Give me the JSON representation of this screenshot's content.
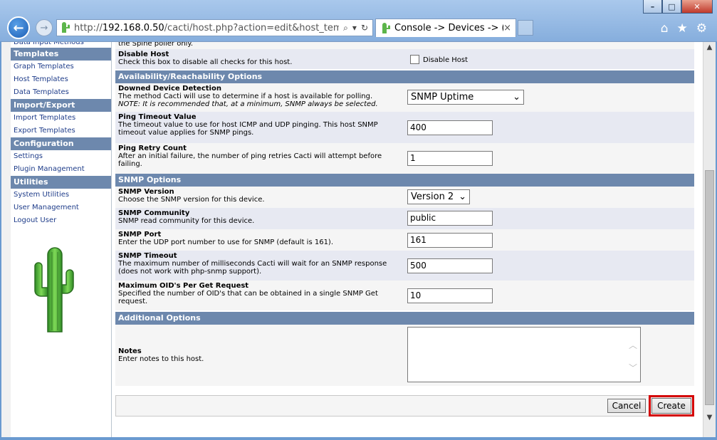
{
  "browser": {
    "address_url_prefix": "http://",
    "address_url_host": "192.168.0.50",
    "address_url_path": "/cacti/host.php?action=edit&host_templat",
    "tab_title": "Console -> Devices -> (...",
    "tab_close": "×",
    "win_min": "–",
    "win_max": "□",
    "win_close": "✕",
    "back_glyph": "←",
    "fwd_glyph": "→",
    "search_glyph": "⌕",
    "dropdown_glyph": "▾",
    "refresh_glyph": "↻",
    "home_glyph": "⌂",
    "fav_glyph": "★",
    "gear_glyph": "⚙"
  },
  "sidebar": {
    "partial_item": "Data Input Methods",
    "sections": [
      {
        "title": "Templates",
        "items": [
          "Graph Templates",
          "Host Templates",
          "Data Templates"
        ]
      },
      {
        "title": "Import/Export",
        "items": [
          "Import Templates",
          "Export Templates"
        ]
      },
      {
        "title": "Configuration",
        "items": [
          "Settings",
          "Plugin Management"
        ]
      },
      {
        "title": "Utilities",
        "items": [
          "System Utilities",
          "User Management",
          "Logout User"
        ]
      }
    ]
  },
  "form": {
    "top_partial_text": "the Spine poller only.",
    "disable_host": {
      "title": "Disable Host",
      "desc": "Check this box to disable all checks for this host.",
      "checkbox_label": "Disable Host"
    },
    "availability_section": "Availability/Reachability Options",
    "downed_detection": {
      "title": "Downed Device Detection",
      "desc": "The method Cacti will use to determine if a host is available for polling.",
      "note": "NOTE: It is recommended that, at a minimum, SNMP always be selected.",
      "value": "SNMP Uptime"
    },
    "ping_timeout": {
      "title": "Ping Timeout Value",
      "desc": "The timeout value to use for host ICMP and UDP pinging. This host SNMP timeout value applies for SNMP pings.",
      "value": "400"
    },
    "ping_retry": {
      "title": "Ping Retry Count",
      "desc": "After an initial failure, the number of ping retries Cacti will attempt before failing.",
      "value": "1"
    },
    "snmp_section": "SNMP Options",
    "snmp_version": {
      "title": "SNMP Version",
      "desc": "Choose the SNMP version for this device.",
      "value": "Version 2"
    },
    "snmp_community": {
      "title": "SNMP Community",
      "desc": "SNMP read community for this device.",
      "value": "public"
    },
    "snmp_port": {
      "title": "SNMP Port",
      "desc": "Enter the UDP port number to use for SNMP (default is 161).",
      "value": "161"
    },
    "snmp_timeout": {
      "title": "SNMP Timeout",
      "desc": "The maximum number of milliseconds Cacti will wait for an SNMP response (does not work with php-snmp support).",
      "value": "500"
    },
    "max_oids": {
      "title": "Maximum OID's Per Get Request",
      "desc": "Specified the number of OID's that can be obtained in a single SNMP Get request.",
      "value": "10"
    },
    "additional_section": "Additional Options",
    "notes": {
      "title": "Notes",
      "desc": "Enter notes to this host.",
      "value": ""
    }
  },
  "actions": {
    "cancel": "Cancel",
    "create": "Create"
  },
  "colors": {
    "section_header": "#6d88ad",
    "link": "#1f3d8a",
    "highlight": "#d40000"
  }
}
